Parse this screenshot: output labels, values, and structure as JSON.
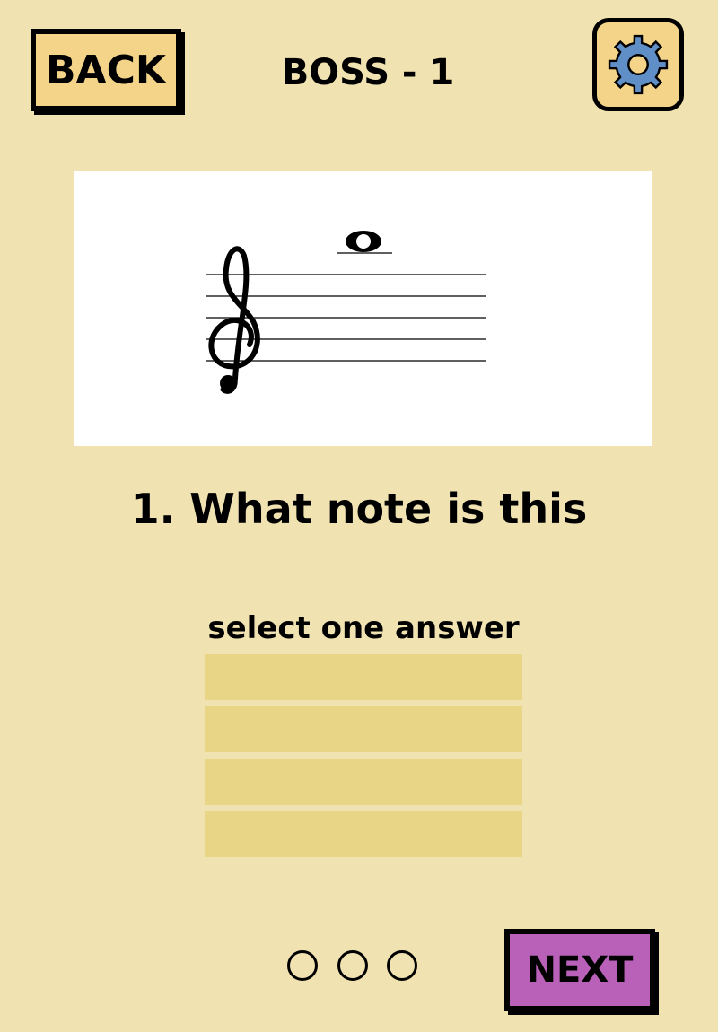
{
  "header": {
    "back_label": "BACK",
    "title": "BOSS - 1",
    "settings_icon": "gear-icon"
  },
  "staff": {
    "clef_icon": "treble-clef-icon",
    "note_icon": "whole-note-icon"
  },
  "question": {
    "text": "1. What note is this",
    "instruction": "select one answer",
    "answers": [
      "",
      "",
      "",
      ""
    ]
  },
  "progress": {
    "total": 3,
    "completed": 0
  },
  "footer": {
    "next_label": "NEXT"
  },
  "colors": {
    "background": "#f0e3b1",
    "back_button": "#f4d488",
    "next_button": "#b961b9",
    "answer_slot": "#e8d586",
    "gear": "#5f8fc6"
  }
}
